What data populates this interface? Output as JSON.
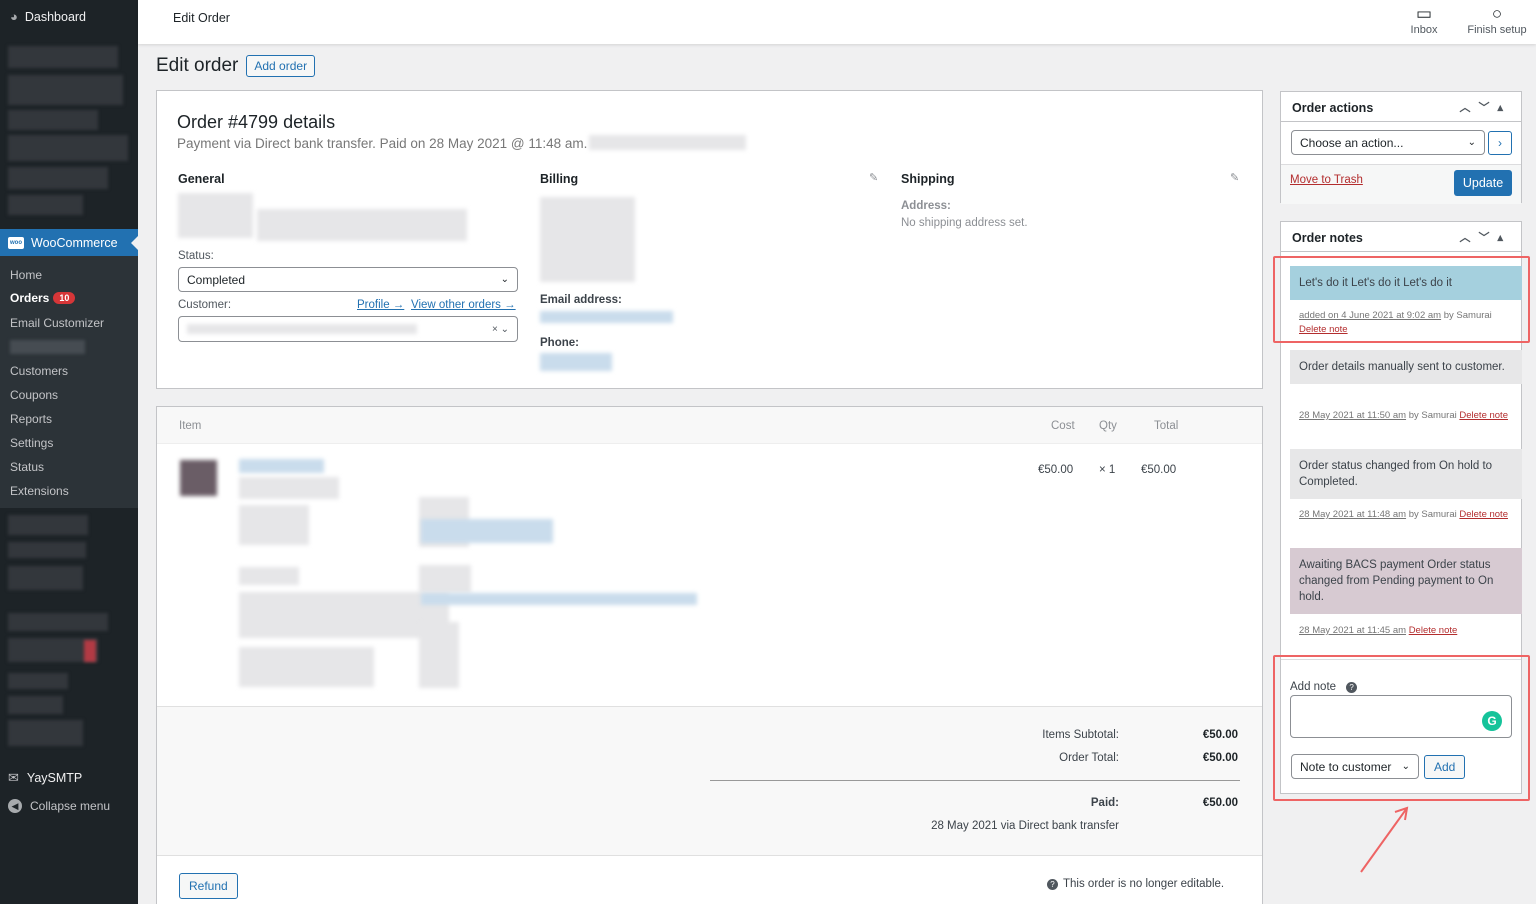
{
  "sidebar": {
    "dashboard": "Dashboard",
    "woocommerce": "WooCommerce",
    "items": [
      {
        "label": "Home"
      },
      {
        "label": "Orders",
        "badge": "10"
      },
      {
        "label": "Email Customizer"
      },
      {
        "label": "Customers"
      },
      {
        "label": "Coupons"
      },
      {
        "label": "Reports"
      },
      {
        "label": "Settings"
      },
      {
        "label": "Status"
      },
      {
        "label": "Extensions"
      }
    ],
    "yaysmtp": "YaySMTP",
    "collapse": "Collapse menu"
  },
  "topbar": {
    "title": "Edit Order",
    "inbox": "Inbox",
    "finish_setup": "Finish setup"
  },
  "page": {
    "title": "Edit order",
    "add_order": "Add order"
  },
  "order": {
    "title": "Order #4799 details",
    "subtitle": "Payment via Direct bank transfer. Paid on 28 May 2021 @ 11:48 am.",
    "general": "General",
    "billing": "Billing",
    "shipping": "Shipping",
    "status_label": "Status:",
    "status_value": "Completed",
    "customer_label": "Customer:",
    "profile_link": "Profile →",
    "view_orders_link": "View other orders →",
    "email_label": "Email address:",
    "phone_label": "Phone:",
    "address_label": "Address:",
    "no_shipping": "No shipping address set."
  },
  "items": {
    "headers": {
      "item": "Item",
      "cost": "Cost",
      "qty": "Qty",
      "total": "Total"
    },
    "row": {
      "cost": "€50.00",
      "qty": "× 1",
      "total": "€50.00"
    },
    "subtotal_label": "Items Subtotal:",
    "subtotal_value": "€50.00",
    "total_label": "Order Total:",
    "total_value": "€50.00",
    "paid_label": "Paid:",
    "paid_value": "€50.00",
    "paid_via": "28 May 2021 via Direct bank transfer",
    "refund": "Refund",
    "not_editable": "This order is no longer editable."
  },
  "order_actions": {
    "title": "Order actions",
    "select": "Choose an action...",
    "trash": "Move to Trash",
    "update": "Update"
  },
  "order_notes": {
    "title": "Order notes",
    "notes": [
      {
        "text": "Let's do it Let's do it Let's do it",
        "date": "added on 4 June 2021 at 9:02 am",
        "by": "by Samurai",
        "delete": "Delete note",
        "color": "#a5d0de"
      },
      {
        "text": "Order details manually sent to customer.",
        "date": "28 May 2021 at 11:50 am",
        "by": "by Samurai",
        "delete": "Delete note",
        "color": "#e7e7e8"
      },
      {
        "text": "Order status changed from On hold to Completed.",
        "date": "28 May 2021 at 11:48 am",
        "by": "by Samurai",
        "delete": "Delete note",
        "color": "#e7e7e8"
      },
      {
        "text": "Awaiting BACS payment Order status changed from Pending payment to On hold.",
        "date": "28 May 2021 at 11:45 am",
        "by": "",
        "delete": "Delete note",
        "color": "#d7cad2"
      }
    ],
    "add_note_label": "Add note",
    "note_type": "Note to customer",
    "add_button": "Add"
  }
}
